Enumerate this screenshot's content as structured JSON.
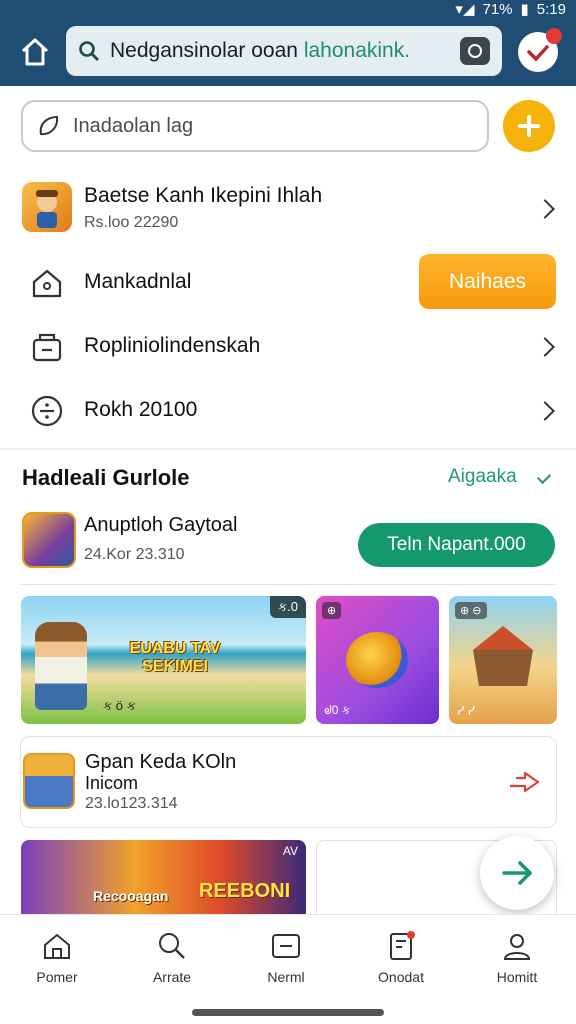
{
  "status_bar": {
    "battery": "71%",
    "time": "5:19"
  },
  "top_search": {
    "text_dark": "Nedgansinolar ooan",
    "text_green": "lahonakink."
  },
  "search_box": {
    "placeholder": "Inadaolan lag"
  },
  "menu": {
    "account": {
      "title": "Baetse Kanh Ikepini Ihlah",
      "subtitle": "Rs.loo 22290"
    },
    "market": {
      "title": "Mankadnlal",
      "button": "Naihaes"
    },
    "reports": {
      "title": "Ropliniolindenskah"
    },
    "rokh": {
      "title": "Rokh 20100"
    }
  },
  "section": {
    "title": "Hadleali Gurlole",
    "link": "Aigaaka"
  },
  "featured_game": {
    "name": "Anuptloh Gaytoal",
    "subtitle": "24.Kor 23.310",
    "button": "Teln Napant.000"
  },
  "banners": {
    "main_headline": "EUABU TAV SEKIMEI",
    "main_badge": "ક.0",
    "main_footer": "ક ö ક",
    "purple_badge": "⊕",
    "purple_footer": "ᖙ0 ક",
    "orange_badge": "⊕ ⊖",
    "orange_footer": "ᓯ ᓯ"
  },
  "second_game": {
    "line1": "Gpan Keda KOln",
    "line2": "Inicom",
    "line3": "23.lo123.314"
  },
  "bottom_banner": {
    "left_text": "Recooagan",
    "right_text": "REEBONI",
    "tag": "AV"
  },
  "bottom_nav": [
    {
      "label": "Pomer",
      "icon": "home-icon"
    },
    {
      "label": "Arrate",
      "icon": "search-icon"
    },
    {
      "label": "Nerml",
      "icon": "message-icon"
    },
    {
      "label": "Onodat",
      "icon": "document-icon"
    },
    {
      "label": "Homitt",
      "icon": "profile-icon"
    }
  ],
  "colors": {
    "app_bar": "#1f4d73",
    "accent_orange": "#f5a00f",
    "accent_green": "#14996a",
    "notification": "#e53935"
  }
}
